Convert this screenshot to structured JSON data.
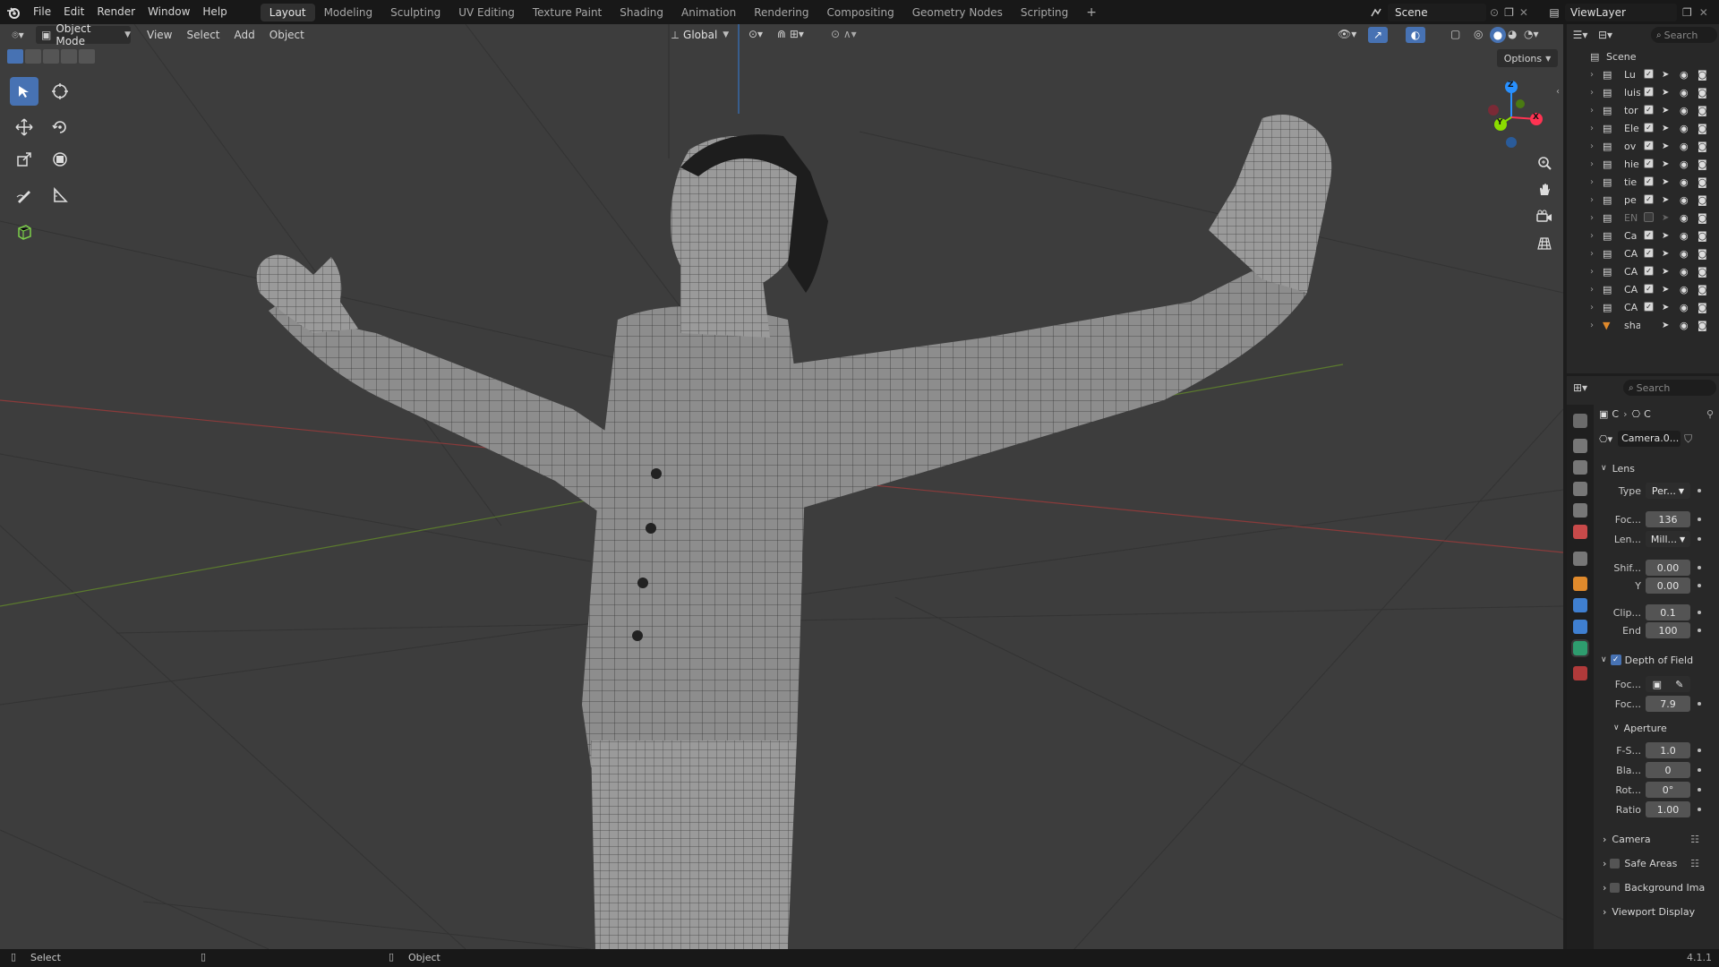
{
  "topbar": {
    "menus": [
      "File",
      "Edit",
      "Render",
      "Window",
      "Help"
    ],
    "workspaces": [
      "Layout",
      "Modeling",
      "Sculpting",
      "UV Editing",
      "Texture Paint",
      "Shading",
      "Animation",
      "Rendering",
      "Compositing",
      "Geometry Nodes",
      "Scripting"
    ],
    "active_workspace": "Layout",
    "add_tab": "+",
    "scene_name": "Scene",
    "view_layer_name": "ViewLayer"
  },
  "viewport": {
    "mode": "Object Mode",
    "menus": [
      "View",
      "Select",
      "Add",
      "Object"
    ],
    "orientation": "Global",
    "options_label": "Options",
    "gizmo": {
      "x": "X",
      "y": "Y",
      "z": "Z"
    }
  },
  "outliner": {
    "search_placeholder": "Search",
    "root": "Scene",
    "items": [
      {
        "name": "Lu",
        "type": "collection",
        "checked": true
      },
      {
        "name": "luis",
        "type": "collection",
        "checked": true
      },
      {
        "name": "tor",
        "type": "collection",
        "checked": true
      },
      {
        "name": "Ele",
        "type": "collection",
        "checked": true
      },
      {
        "name": "ov",
        "type": "collection",
        "checked": true
      },
      {
        "name": "hie",
        "type": "collection",
        "checked": true
      },
      {
        "name": "tie",
        "type": "collection",
        "checked": true
      },
      {
        "name": "pe",
        "type": "collection",
        "checked": true
      },
      {
        "name": "EN",
        "type": "collection",
        "checked": false
      },
      {
        "name": "Ca",
        "type": "collection",
        "checked": true
      },
      {
        "name": "CA",
        "type": "collection",
        "checked": true
      },
      {
        "name": "CA",
        "type": "collection",
        "checked": true
      },
      {
        "name": "CA",
        "type": "collection",
        "checked": true
      },
      {
        "name": "CA",
        "type": "collection",
        "checked": true
      },
      {
        "name": "sha",
        "type": "shader",
        "checked": false
      }
    ]
  },
  "properties": {
    "search_placeholder": "Search",
    "breadcrumb": [
      "C",
      "C"
    ],
    "datablock": "Camera.0...",
    "lens": {
      "header": "Lens",
      "type_label": "Type",
      "type_value": "Per...",
      "focal_label": "Foc...",
      "focal_value": "136",
      "lens_unit_label": "Len...",
      "lens_unit_value": "Mill...",
      "shift_label": "Shif...",
      "shift_x": "0.00",
      "shift_y_label": "Y",
      "shift_y": "0.00",
      "clip_label": "Clip...",
      "clip_start": "0.1",
      "clip_end_label": "End",
      "clip_end": "100"
    },
    "dof": {
      "header": "Depth of Field",
      "enabled": true,
      "focus_obj_label": "Foc...",
      "focus_dist_label": "Foc...",
      "focus_dist": "7.9",
      "aperture_header": "Aperture",
      "fstop_label": "F-S...",
      "fstop": "1.0",
      "blades_label": "Bla...",
      "blades": "0",
      "rotation_label": "Rot...",
      "rotation": "0°",
      "ratio_label": "Ratio",
      "ratio": "1.00"
    },
    "panels": [
      "Camera",
      "Safe Areas",
      "Background Ima",
      "Viewport Display"
    ]
  },
  "status": {
    "left_action": "Select",
    "mid_action": "Object",
    "version": "4.1.1"
  },
  "colors": {
    "accent": "#4772b3",
    "axis_x": "#ff3352",
    "axis_y": "#8bdc00",
    "axis_z": "#2890ff"
  }
}
